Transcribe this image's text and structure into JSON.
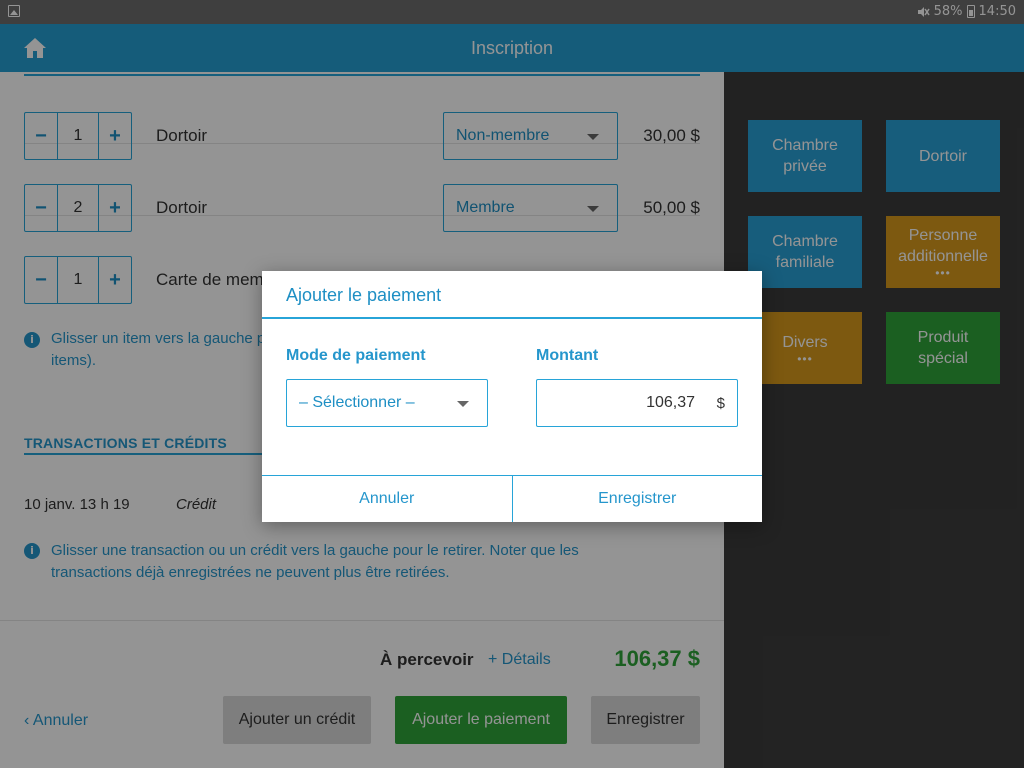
{
  "status_bar": {
    "battery": "58%",
    "time": "14:50"
  },
  "app_bar": {
    "title": "Inscription"
  },
  "items": [
    {
      "qty": "1",
      "name": "Dortoir",
      "tariff": "Non-membre",
      "price": "30,00 $"
    },
    {
      "qty": "2",
      "name": "Dortoir",
      "tariff": "Membre",
      "price": "50,00 $"
    },
    {
      "qty": "1",
      "name": "Carte de membre"
    }
  ],
  "stepper": {
    "minus": "−",
    "plus": "+"
  },
  "items_hint_line1": "Glisser un item vers la gauche pour le retirer (ou pour voir plus d'options sur les",
  "items_hint_line2": "items).",
  "transactions": {
    "title": "TRANSACTIONS ET CRÉDITS",
    "rows": [
      {
        "date": "10 janv. 13 h 19",
        "type": "Crédit"
      }
    ],
    "hint_line1": "Glisser une transaction ou un crédit vers la gauche pour le retirer. Noter que les",
    "hint_line2": "transactions déjà enregistrées ne peuvent plus être retirées."
  },
  "footer": {
    "due_label": "À percevoir",
    "details_link": "+ Détails",
    "due_amount": "106,37 $",
    "cancel_link": "‹ Annuler",
    "add_credit": "Ajouter un crédit",
    "add_payment": "Ajouter le paiement",
    "save": "Enregistrer"
  },
  "tiles": [
    {
      "line1": "Chambre",
      "line2": "privée",
      "color": "#28a0d6"
    },
    {
      "line1": "Dortoir",
      "color": "#28a0d6"
    },
    {
      "line1": "Chambre",
      "line2": "familiale",
      "color": "#28a0d6"
    },
    {
      "line1": "Personne",
      "line2": "additionnelle",
      "more": "•••",
      "color": "#d79a1c"
    },
    {
      "line1": "Divers",
      "more": "•••",
      "color": "#d79a1c"
    },
    {
      "line1": "Produit",
      "line2": "spécial",
      "color": "#2fa43a"
    }
  ],
  "dialog": {
    "title": "Ajouter le paiement",
    "mode_label": "Mode de paiement",
    "mode_value": "– Sélectionner –",
    "amount_label": "Montant",
    "amount_value": "106,37",
    "currency": "$",
    "cancel": "Annuler",
    "save": "Enregistrer"
  },
  "colors": {
    "primary": "#259fd3",
    "green": "#2fa43a",
    "orange": "#d79a1c",
    "dark_pane": "#3c3c3c"
  }
}
